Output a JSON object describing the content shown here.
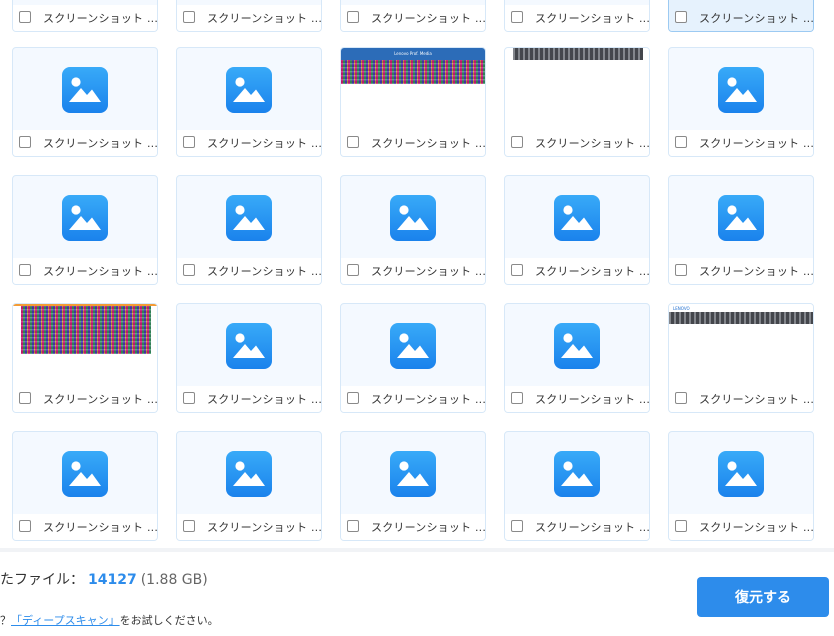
{
  "colors": {
    "accent": "#2d8ceb",
    "card_bg": "#f4f9ff",
    "card_border": "#d7e8f8",
    "icon_gradient_top": "#38aaf8",
    "icon_gradient_bottom": "#1a82ec"
  },
  "grid": {
    "items": [
      {
        "name": "スクリーンショット ...",
        "thumb": "partial",
        "selected": false
      },
      {
        "name": "スクリーンショット ...",
        "thumb": "partial",
        "selected": false
      },
      {
        "name": "スクリーンショット ...",
        "thumb": "partial",
        "selected": false
      },
      {
        "name": "スクリーンショット ...",
        "thumb": "partial",
        "selected": false
      },
      {
        "name": "スクリーンショット ...",
        "thumb": "partial",
        "selected": true
      },
      {
        "name": "スクリーンショット ...",
        "thumb": "image-icon",
        "selected": false
      },
      {
        "name": "スクリーンショット ...",
        "thumb": "image-icon",
        "selected": false
      },
      {
        "name": "スクリーンショット ...",
        "thumb": "screenshot-blue",
        "selected": false,
        "preview_title": "Lenovo Prof. Media"
      },
      {
        "name": "スクリーンショット ...",
        "thumb": "screenshot-gray",
        "selected": false
      },
      {
        "name": "スクリーンショット ...",
        "thumb": "image-icon",
        "selected": false
      },
      {
        "name": "スクリーンショット ...",
        "thumb": "image-icon",
        "selected": false
      },
      {
        "name": "スクリーンショット ...",
        "thumb": "image-icon",
        "selected": false
      },
      {
        "name": "スクリーンショット ...",
        "thumb": "image-icon",
        "selected": false
      },
      {
        "name": "スクリーンショット ...",
        "thumb": "image-icon",
        "selected": false
      },
      {
        "name": "スクリーンショット ...",
        "thumb": "image-icon",
        "selected": false
      },
      {
        "name": "スクリーンショット ...",
        "thumb": "screenshot-noise",
        "selected": false
      },
      {
        "name": "スクリーンショット ...",
        "thumb": "image-icon",
        "selected": false
      },
      {
        "name": "スクリーンショット ...",
        "thumb": "image-icon",
        "selected": false
      },
      {
        "name": "スクリーンショット ...",
        "thumb": "image-icon",
        "selected": false
      },
      {
        "name": "スクリーンショット ...",
        "thumb": "screenshot-wide",
        "selected": false,
        "preview_title": "LENOVO"
      },
      {
        "name": "スクリーンショット ...",
        "thumb": "image-icon",
        "selected": false
      },
      {
        "name": "スクリーンショット ...",
        "thumb": "image-icon",
        "selected": false
      },
      {
        "name": "スクリーンショット ...",
        "thumb": "image-icon",
        "selected": false
      },
      {
        "name": "スクリーンショット ...",
        "thumb": "image-icon",
        "selected": false
      },
      {
        "name": "スクリーンショット ...",
        "thumb": "image-icon",
        "selected": false
      }
    ]
  },
  "footer": {
    "total_label": "たファイル：",
    "total_count": "14127",
    "total_size": "(1.88 GB)",
    "tip_prefix": "？",
    "tip_link": "「ディープスキャン」",
    "tip_suffix": "をお試しください。",
    "restore_label": "復元する"
  }
}
